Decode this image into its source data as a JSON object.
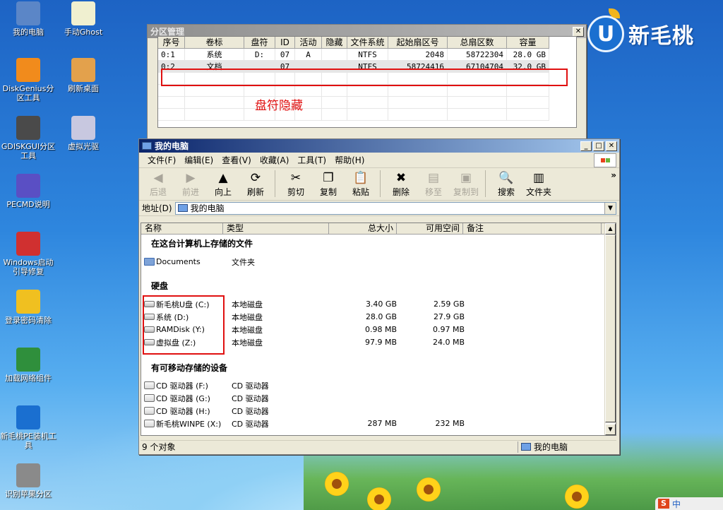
{
  "desktop": {
    "icons": [
      {
        "label": "我的电脑",
        "icon": "computer-icon",
        "color": "#5b86c7"
      },
      {
        "label": "手动Ghost",
        "icon": "ghost-icon",
        "color": "#f0f0d0"
      },
      {
        "label": "DiskGenius分区工具",
        "icon": "diskgenius-icon",
        "color": "#f18b1c"
      },
      {
        "label": "刷新桌面",
        "icon": "refresh-desktop-icon",
        "color": "#e3a14c"
      },
      {
        "label": "GDISKGUI分区工具",
        "icon": "gdisk-icon",
        "color": "#4a4a4a"
      },
      {
        "label": "虚拟光驱",
        "icon": "virtual-drive-icon",
        "color": "#c8c8e0"
      },
      {
        "label": "PECMD说明",
        "icon": "help-icon",
        "color": "#5a4fc4"
      },
      {
        "label": "Windows启动引导修复",
        "icon": "boot-repair-icon",
        "color": "#d03030"
      },
      {
        "label": "登录密码清除",
        "icon": "key-icon",
        "color": "#f0c020"
      },
      {
        "label": "加载网络组件",
        "icon": "network-icon",
        "color": "#2f8f3c"
      },
      {
        "label": "新毛桃PE装机工具",
        "icon": "pe-installer-icon",
        "color": "#1a6fd0"
      },
      {
        "label": "识别苹果分区",
        "icon": "apple-partition-icon",
        "color": "#8a8a8a"
      }
    ],
    "brand": {
      "mark": "U",
      "text": "新毛桃"
    },
    "tray": {
      "badge": "S",
      "text": "中"
    }
  },
  "partition_window": {
    "title": "分区管理",
    "columns": [
      "序号",
      "卷标",
      "盘符",
      "ID",
      "活动",
      "隐藏",
      "文件系统",
      "起始扇区号",
      "总扇区数",
      "容量"
    ],
    "rows": [
      [
        "0:1",
        "系统",
        "D:",
        "07",
        "A",
        "",
        "NTFS",
        "2048",
        "58722304",
        "28.0 GB"
      ],
      [
        "0:2",
        "文档",
        "",
        "07",
        "",
        "",
        "NTFS",
        "58724416",
        "67104704",
        "32.0 GB"
      ]
    ],
    "annotation": "盘符隐藏"
  },
  "explorer": {
    "title": "我的电脑",
    "menu": [
      "文件(F)",
      "编辑(E)",
      "查看(V)",
      "收藏(A)",
      "工具(T)",
      "帮助(H)"
    ],
    "toolbar": [
      {
        "label": "后退",
        "icon": "back-arrow-icon",
        "glyph": "◀",
        "disabled": true
      },
      {
        "label": "前进",
        "icon": "forward-arrow-icon",
        "glyph": "▶",
        "disabled": true
      },
      {
        "label": "向上",
        "icon": "up-arrow-icon",
        "glyph": "▲",
        "disabled": false
      },
      {
        "label": "刷新",
        "icon": "refresh-icon",
        "glyph": "⟳",
        "disabled": false
      },
      {
        "label": "剪切",
        "icon": "scissors-icon",
        "glyph": "✂",
        "disabled": false
      },
      {
        "label": "复制",
        "icon": "copy-icon",
        "glyph": "❐",
        "disabled": false
      },
      {
        "label": "粘贴",
        "icon": "paste-icon",
        "glyph": "📋",
        "disabled": false
      },
      {
        "label": "删除",
        "icon": "delete-icon",
        "glyph": "✖",
        "disabled": false
      },
      {
        "label": "移至",
        "icon": "move-to-icon",
        "glyph": "▤",
        "disabled": true
      },
      {
        "label": "复制到",
        "icon": "copy-to-icon",
        "glyph": "▣",
        "disabled": true
      },
      {
        "label": "搜索",
        "icon": "search-icon",
        "glyph": "🔍",
        "disabled": false
      },
      {
        "label": "文件夹",
        "icon": "folders-icon",
        "glyph": "▥",
        "disabled": false
      }
    ],
    "more_glyph": "»",
    "address_label": "地址(D)",
    "address_value": "我的电脑",
    "columns": [
      "名称",
      "类型",
      "总大小",
      "可用空间",
      "备注"
    ],
    "group_files": "在这台计算机上存储的文件",
    "files": [
      {
        "name": "Documents",
        "type": "文件夹"
      }
    ],
    "group_disks": "硬盘",
    "disks": [
      {
        "name": "新毛桃U盘 (C:)",
        "type": "本地磁盘",
        "total": "3.40 GB",
        "free": "2.59 GB"
      },
      {
        "name": "系统 (D:)",
        "type": "本地磁盘",
        "total": "28.0 GB",
        "free": "27.9 GB"
      },
      {
        "name": "RAMDisk (Y:)",
        "type": "本地磁盘",
        "total": "0.98 MB",
        "free": "0.97 MB"
      },
      {
        "name": "虚拟盘 (Z:)",
        "type": "本地磁盘",
        "total": "97.9 MB",
        "free": "24.0 MB"
      }
    ],
    "group_removable": "有可移动存储的设备",
    "removable": [
      {
        "name": "CD 驱动器 (F:)",
        "type": "CD 驱动器",
        "total": "",
        "free": ""
      },
      {
        "name": "CD 驱动器 (G:)",
        "type": "CD 驱动器",
        "total": "",
        "free": ""
      },
      {
        "name": "CD 驱动器 (H:)",
        "type": "CD 驱动器",
        "total": "",
        "free": ""
      },
      {
        "name": "新毛桃WINPE (X:)",
        "type": "CD 驱动器",
        "total": "287 MB",
        "free": "232 MB"
      }
    ],
    "status_left": "9 个对象",
    "status_right": "我的电脑"
  }
}
